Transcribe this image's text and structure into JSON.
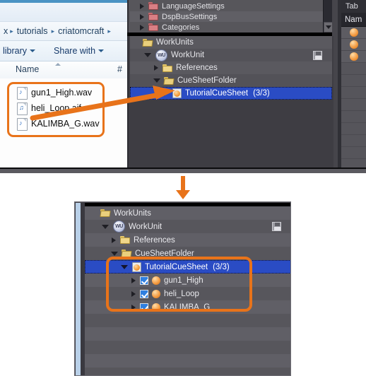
{
  "explorer": {
    "breadcrumb": {
      "items": [
        "tutorials",
        "criatomcraft"
      ],
      "leading_sep": "▸",
      "trailing_sep": "▸",
      "prefix_fragment": "x"
    },
    "toolbar": {
      "library_label": "library",
      "share_label": "Share with"
    },
    "columns": {
      "name": "Name",
      "number": "#"
    },
    "files": [
      {
        "name": "gun1_High.wav",
        "icon": "audio-wav-file-icon",
        "glyph": "♪"
      },
      {
        "name": "heli_Loop.aif",
        "icon": "audio-aif-file-icon",
        "glyph": "♫"
      },
      {
        "name": "KALIMBA_G.wav",
        "icon": "audio-wav-file-icon",
        "glyph": "♪"
      }
    ]
  },
  "top_tree": {
    "partial_rows": [
      {
        "label": "LanguageSettings",
        "icon": "red-folder-icon",
        "expander": "collapsed"
      },
      {
        "label": "DspBusSettings",
        "icon": "red-folder-icon",
        "expander": "collapsed"
      },
      {
        "label": "Categories",
        "icon": "red-folder-icon",
        "expander": "collapsed"
      }
    ],
    "rows": [
      {
        "label": "WorkUnits",
        "icon": "yellow-folder-open-icon",
        "expander": "none",
        "indent": 0,
        "selected": false
      },
      {
        "label": "WorkUnit",
        "icon": "work-unit-icon",
        "icon_text": "WU",
        "expander": "expanded",
        "indent": 1,
        "selected": false,
        "trailing_icon": "save-disk-icon"
      },
      {
        "label": "References",
        "icon": "yellow-folder-icon",
        "expander": "collapsed",
        "indent": 2,
        "selected": false
      },
      {
        "label": "CueSheetFolder",
        "icon": "yellow-folder-open-icon",
        "expander": "expanded",
        "indent": 2,
        "selected": false
      },
      {
        "label": "TutorialCueSheet",
        "count": "(3/3)",
        "icon": "cue-sheet-icon",
        "expander": "collapsed",
        "indent": 3,
        "selected": true
      }
    ],
    "scrollbar": {
      "down_arrow": "▼"
    }
  },
  "right_panel": {
    "tab_label": "Tab",
    "column_header": "Nam",
    "rows": [
      {
        "icon": "orange-sphere-icon"
      },
      {
        "icon": "orange-sphere-icon"
      },
      {
        "icon": "orange-sphere-icon"
      },
      {
        "icon": ""
      },
      {
        "icon": ""
      },
      {
        "icon": ""
      },
      {
        "icon": ""
      },
      {
        "icon": ""
      },
      {
        "icon": ""
      },
      {
        "icon": ""
      },
      {
        "icon": ""
      }
    ]
  },
  "bottom_tree": {
    "rows": [
      {
        "label": "WorkUnits",
        "icon": "yellow-folder-open-icon",
        "expander": "none",
        "indent": 0,
        "selected": false,
        "checkbox": false
      },
      {
        "label": "WorkUnit",
        "icon": "work-unit-icon",
        "icon_text": "WU",
        "expander": "expanded",
        "indent": 1,
        "selected": false,
        "checkbox": false,
        "trailing_icon": "save-disk-icon"
      },
      {
        "label": "References",
        "icon": "yellow-folder-icon",
        "expander": "collapsed",
        "indent": 2,
        "selected": false,
        "checkbox": false
      },
      {
        "label": "CueSheetFolder",
        "icon": "yellow-folder-open-icon",
        "expander": "expanded",
        "indent": 2,
        "selected": false,
        "checkbox": false
      },
      {
        "label": "TutorialCueSheet",
        "count": "(3/3)",
        "icon": "cue-sheet-icon",
        "expander": "expanded",
        "indent": 3,
        "selected": true,
        "checkbox": false
      },
      {
        "label": "gun1_High",
        "icon": "orange-sphere-icon",
        "expander": "collapsed",
        "indent": 4,
        "selected": false,
        "checkbox": true
      },
      {
        "label": "heli_Loop",
        "icon": "orange-sphere-icon",
        "expander": "collapsed",
        "indent": 4,
        "selected": false,
        "checkbox": true
      },
      {
        "label": "KALIMBA_G",
        "icon": "orange-sphere-icon",
        "expander": "collapsed",
        "indent": 4,
        "selected": false,
        "checkbox": true
      }
    ]
  },
  "annotations": {
    "highlight_color": "#e8731a",
    "drag_arrow": "drag-and-drop-arrow",
    "flow_arrow": "downward-flow-arrow"
  }
}
